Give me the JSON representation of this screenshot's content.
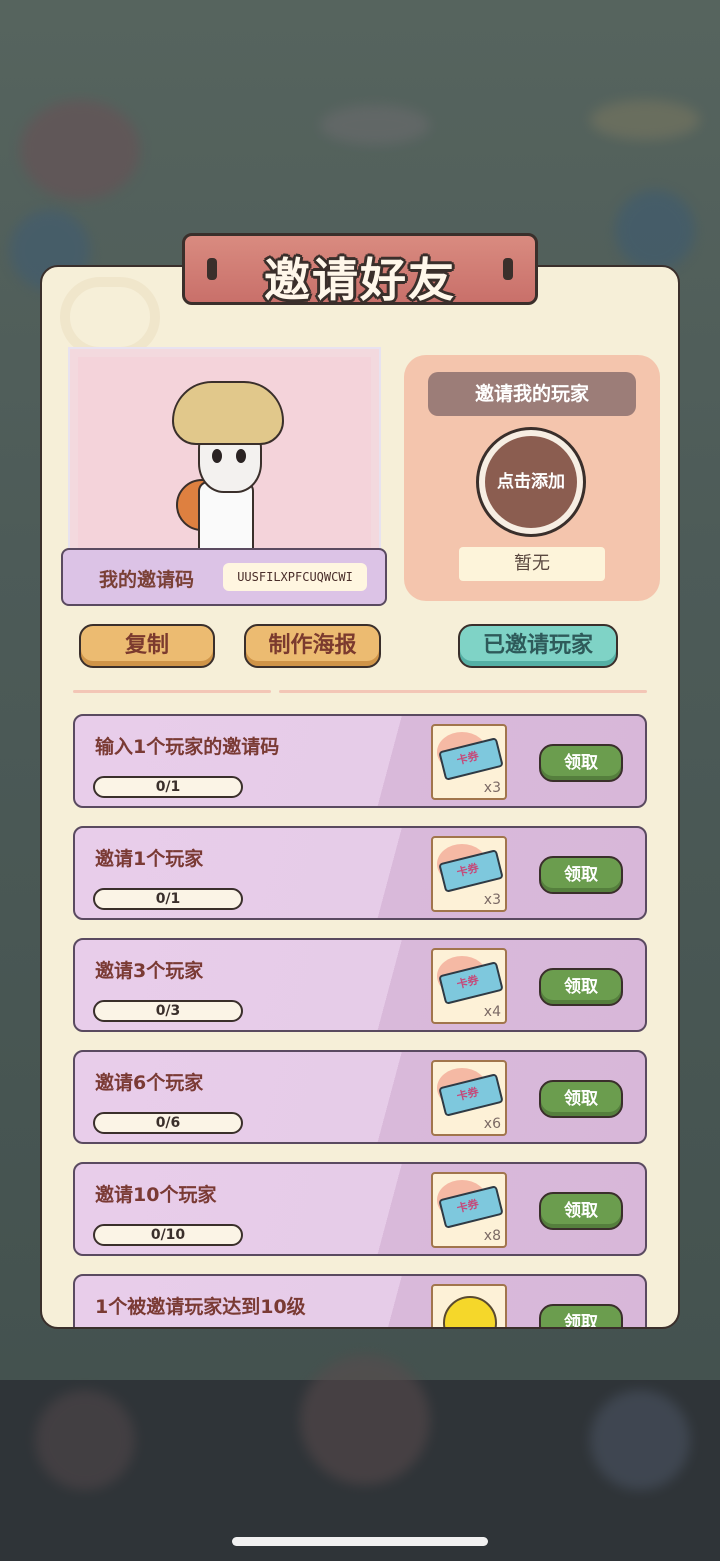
{
  "dialog": {
    "title": "邀请好友",
    "my_code_label": "我的邀请码",
    "my_code_value": "UUSFILXPFCUQWCWI",
    "inviter": {
      "title": "邀请我的玩家",
      "add_label": "点击添加",
      "none_label": "暂无"
    },
    "buttons": {
      "copy": "复制",
      "poster": "制作海报",
      "invited_players": "已邀请玩家"
    },
    "claim_label": "领取",
    "reward_ticket_text": "卡券",
    "tasks": [
      {
        "label": "输入1个玩家的邀请码",
        "progress": "0/1",
        "reward_qty": "x3"
      },
      {
        "label": "邀请1个玩家",
        "progress": "0/1",
        "reward_qty": "x3"
      },
      {
        "label": "邀请3个玩家",
        "progress": "0/3",
        "reward_qty": "x4"
      },
      {
        "label": "邀请6个玩家",
        "progress": "0/6",
        "reward_qty": "x6"
      },
      {
        "label": "邀请10个玩家",
        "progress": "0/10",
        "reward_qty": "x8"
      },
      {
        "label": "1个被邀请玩家达到10级"
      }
    ]
  }
}
